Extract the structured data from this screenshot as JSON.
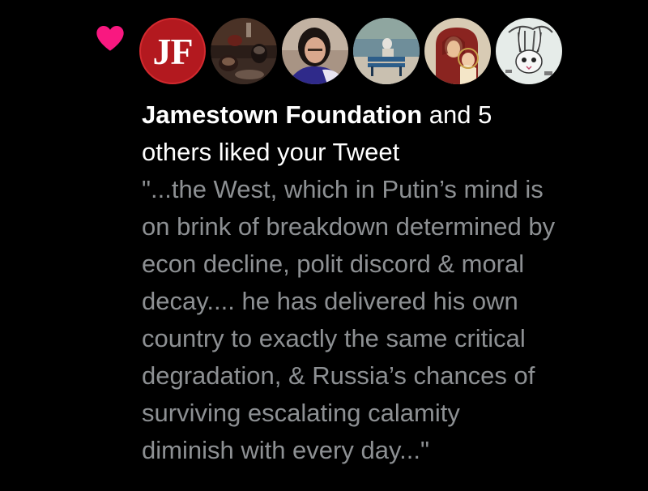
{
  "notification": {
    "type": "like",
    "heart_color": "#f91880",
    "actor_name": "Jamestown Foundation",
    "actor_suffix": " and 5",
    "action_text": "others liked your Tweet",
    "tweet_text": "\"...the West, which in Putin’s mind is\non brink of breakdown determined by\necon decline, polit discord & moral\ndecay.... he has delivered his own\ncountry to exactly the same critical\ndegradation, & Russia’s chances of\nsurviving escalating calamity\ndiminish with every day...\""
  },
  "avatars": [
    {
      "kind": "logo",
      "text": "JF",
      "color": "#b3191f"
    },
    {
      "kind": "photo",
      "subject": "wine glasses on table"
    },
    {
      "kind": "photo",
      "subject": "woman with dark hair"
    },
    {
      "kind": "photo",
      "subject": "person on bench by water"
    },
    {
      "kind": "photo",
      "subject": "religious icon painting"
    },
    {
      "kind": "photo",
      "subject": "rabbit illustration"
    }
  ]
}
